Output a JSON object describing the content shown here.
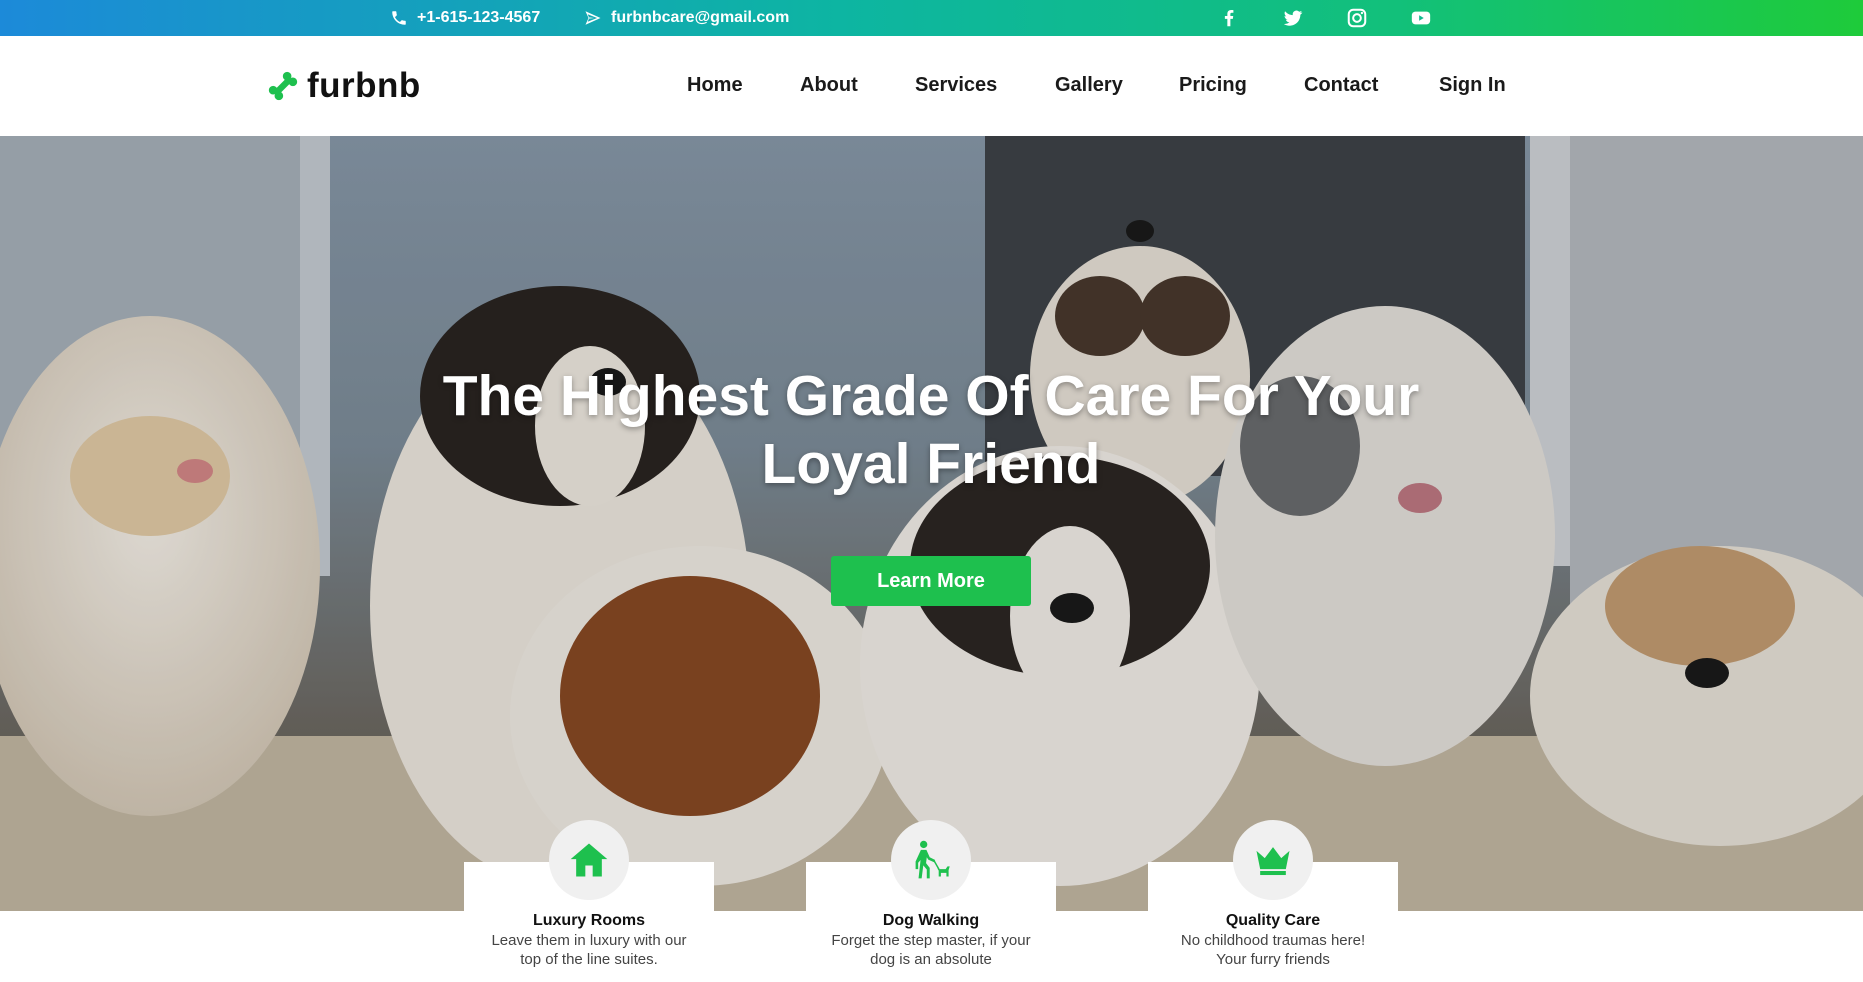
{
  "topbar": {
    "phone": "+1-615-123-4567",
    "email": "furbnbcare@gmail.com",
    "social": [
      "facebook-icon",
      "twitter-icon",
      "instagram-icon",
      "youtube-icon"
    ],
    "gradient": [
      "#1c8ad9",
      "#0db5a2",
      "#1ecb3a"
    ]
  },
  "brand": {
    "name": "furbnb",
    "accent": "#1ec04e"
  },
  "nav": {
    "items": [
      "Home",
      "About",
      "Services",
      "Gallery",
      "Pricing",
      "Contact",
      "Sign In"
    ]
  },
  "hero": {
    "title": "The Highest Grade Of Care For Your Loyal Friend",
    "button": "Learn More"
  },
  "features": [
    {
      "icon": "house-icon",
      "title": "Luxury Rooms",
      "text": "Leave them in luxury with our top of the line suites."
    },
    {
      "icon": "dog-walker-icon",
      "title": "Dog Walking",
      "text": "Forget the step master, if your dog is an absolute"
    },
    {
      "icon": "crown-icon",
      "title": "Quality Care",
      "text": "No childhood traumas here! Your furry friends"
    }
  ]
}
